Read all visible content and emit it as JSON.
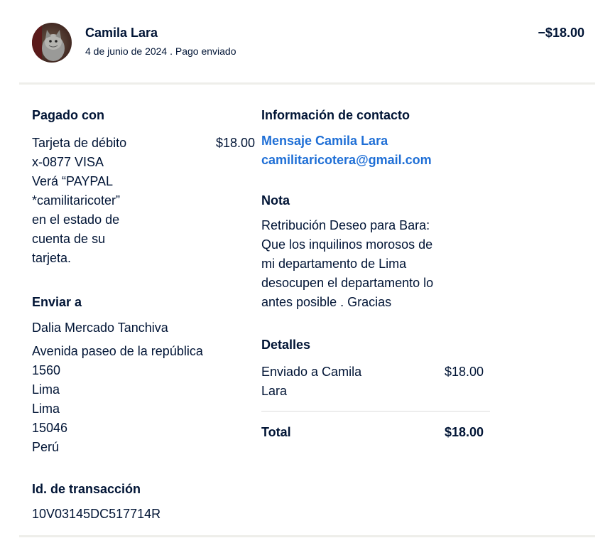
{
  "header": {
    "name": "Camila Lara",
    "date_status": "4 de junio de 2024 . Pago enviado",
    "amount": "−$18.00"
  },
  "paid_with": {
    "title": "Pagado con",
    "lines": [
      "Tarjeta de débito",
      "x-0877 VISA",
      "Verá “PAYPAL",
      "*camilitaricoter”",
      "en el estado de",
      "cuenta de su",
      "tarjeta."
    ],
    "amount": "$18.00"
  },
  "ship_to": {
    "title": "Enviar a",
    "name": "Dalia Mercado Tanchiva",
    "lines": [
      "Avenida paseo de la república",
      "1560",
      "Lima",
      "Lima",
      "15046",
      "Perú"
    ]
  },
  "transaction": {
    "title": "Id. de transacción",
    "id": "10V03145DC517714R"
  },
  "contact": {
    "title": "Información de contacto",
    "message_link": "Mensaje Camila Lara",
    "email_link": "camilitaricotera@gmail.com"
  },
  "note": {
    "title": "Nota",
    "lines": [
      "Retribución Deseo para Bara:",
      "Que los inquilinos morosos de",
      "mi departamento de Lima",
      "desocupen el departamento lo",
      "antes posible . Gracias"
    ]
  },
  "details": {
    "title": "Detalles",
    "item_lines": [
      "Enviado a Camila",
      "Lara"
    ],
    "item_amount": "$18.00",
    "total_label": "Total",
    "total_amount": "$18.00"
  },
  "colors": {
    "text": "#001435",
    "link": "#1f6fd6",
    "divider": "#eeeeea"
  }
}
